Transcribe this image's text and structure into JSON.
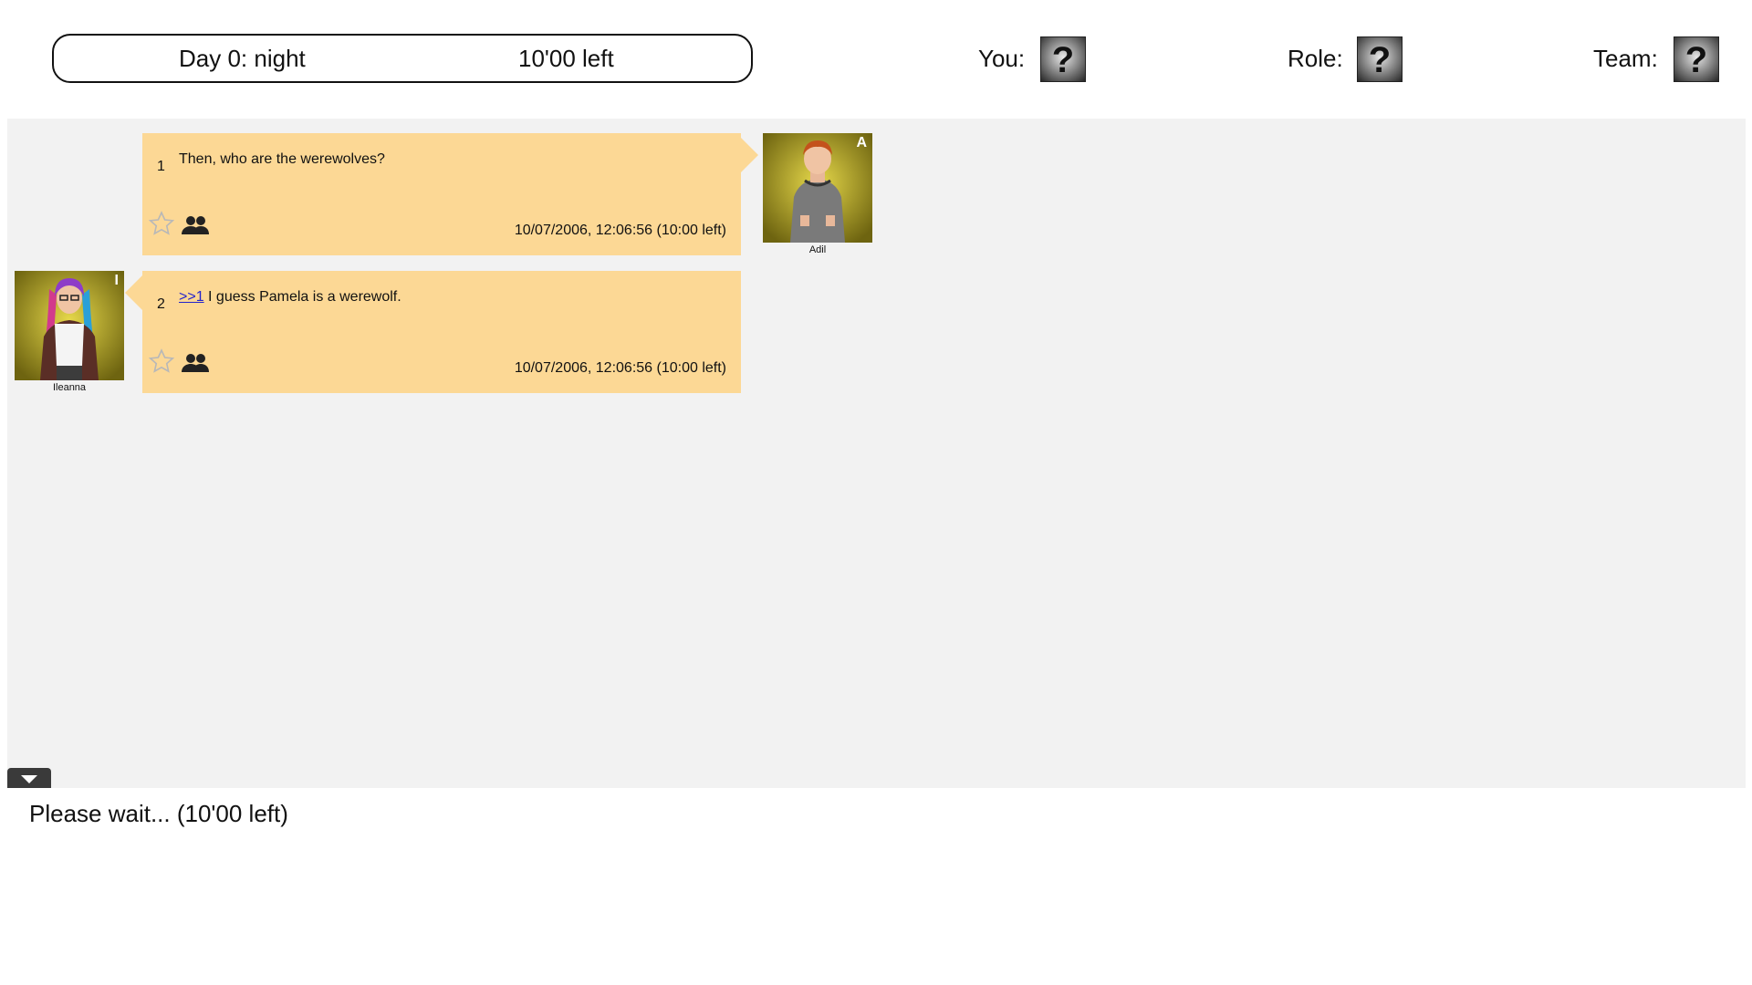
{
  "header": {
    "day_label": "Day 0: night",
    "timer_label": "10'00 left",
    "you_label": "You:",
    "role_label": "Role:",
    "team_label": "Team:",
    "unknown_symbol": "?"
  },
  "messages": [
    {
      "number": "1",
      "text": "Then, who are the werewolves?",
      "reply_ref": "",
      "timestamp": "10/07/2006, 12:06:56 (10:00 left)",
      "speaker": {
        "name": "Adil",
        "initial": "A",
        "side": "right"
      }
    },
    {
      "number": "2",
      "reply_ref": ">>1",
      "text": " I guess Pamela is a werewolf.",
      "timestamp": "10/07/2006, 12:06:56 (10:00 left)",
      "speaker": {
        "name": "Ileanna",
        "initial": "I",
        "side": "left"
      }
    }
  ],
  "footer": {
    "wait_message": "Please wait... (10'00 left)"
  },
  "icons": {
    "favorite": "star-outline-icon",
    "audience": "people-icon",
    "scroll": "caret-down-icon"
  },
  "colors": {
    "bubble": "#fcd895",
    "log_background": "#f2f2f2",
    "link": "#2323cc",
    "avatar_background": "#c8b020"
  }
}
